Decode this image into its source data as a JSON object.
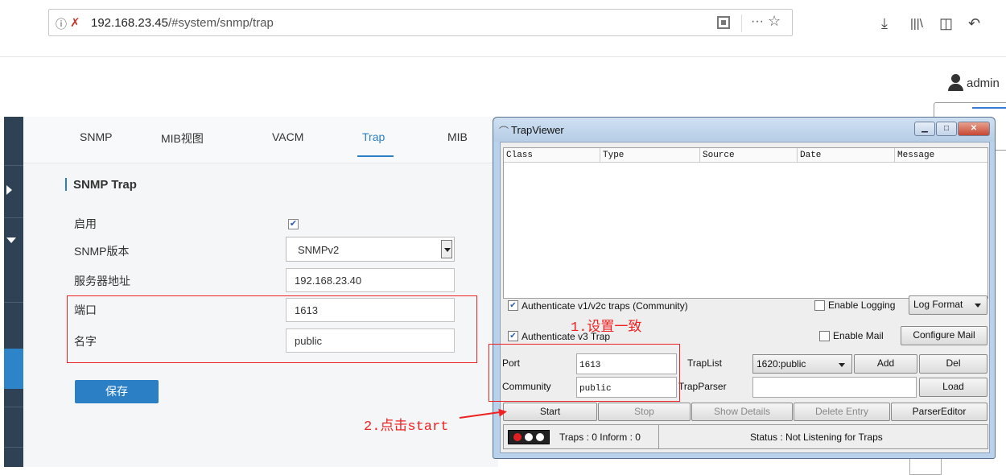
{
  "browser": {
    "url_host": "192.168.23.45",
    "url_path": "/#system/snmp/trap",
    "info_icon": "info-icon",
    "insecure_icon": "insecure-lock-icon"
  },
  "header": {
    "user": "admin"
  },
  "tabs": [
    {
      "label": "SNMP"
    },
    {
      "label": "MIB视图"
    },
    {
      "label": "VACM"
    },
    {
      "label": "Trap",
      "active": true
    },
    {
      "label": "MIB"
    }
  ],
  "form": {
    "section_title": "SNMP Trap",
    "enable_label": "启用",
    "enable_checked": true,
    "version_label": "SNMP版本",
    "version_value": "SNMPv2",
    "server_label": "服务器地址",
    "server_value": "192.168.23.40",
    "port_label": "端口",
    "port_value": "1613",
    "name_label": "名字",
    "name_value": "public",
    "save_label": "保存"
  },
  "trapviewer": {
    "title": "TrapViewer",
    "columns": [
      "Class",
      "Type",
      "Source",
      "Date",
      "Message"
    ],
    "auth_v1v2c_label": "Authenticate v1/v2c traps (Community)",
    "auth_v1v2c_checked": true,
    "auth_v3_label": "Authenticate v3 Trap",
    "auth_v3_checked": true,
    "enable_logging_label": "Enable Logging",
    "log_format_label": "Log Format",
    "enable_mail_label": "Enable Mail",
    "configure_mail_label": "Configure Mail",
    "port_label": "Port",
    "port_value": "1613",
    "community_label": "Community",
    "community_value": "public",
    "traplist_label": "TrapList",
    "traplist_value": "1620:public",
    "trapparser_label": "TrapParser",
    "add_label": "Add",
    "del_label": "Del",
    "load_label": "Load",
    "start_label": "Start",
    "stop_label": "Stop",
    "show_details_label": "Show Details",
    "delete_entry_label": "Delete Entry",
    "parser_editor_label": "ParserEditor",
    "counts_text": "Traps : 0 Inform : 0",
    "status_text": "Status : Not Listening for Traps"
  },
  "annotations": {
    "step1_num": "1.",
    "step1_text": "设置一致",
    "step2_num": "2.",
    "step2_cn": "点击",
    "step2_en": "start"
  },
  "colors": {
    "accent": "#2a7fc5",
    "sidebar": "#2f4155",
    "annotation": "#e22222"
  }
}
